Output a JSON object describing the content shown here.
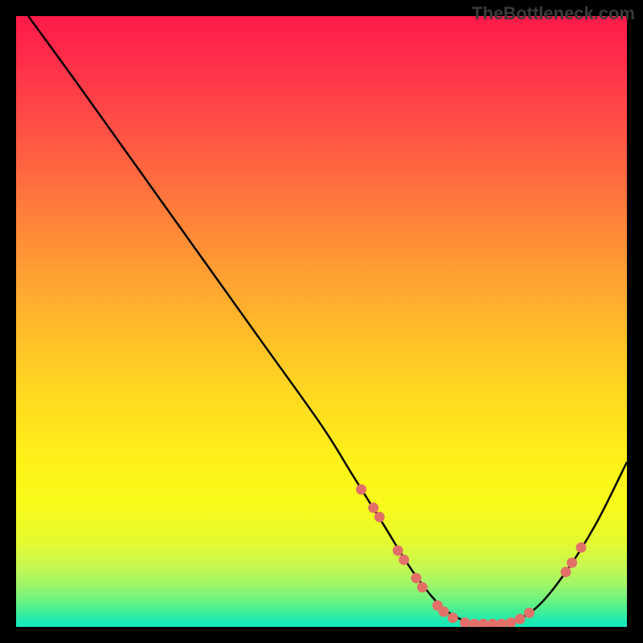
{
  "watermark": "TheBottleneck.com",
  "chart_data": {
    "type": "line",
    "title": "",
    "xlabel": "",
    "ylabel": "",
    "xlim": [
      0,
      100
    ],
    "ylim": [
      0,
      100
    ],
    "series": [
      {
        "name": "bottleneck-curve",
        "color": "#000000",
        "x": [
          2,
          10,
          20,
          30,
          40,
          50,
          55,
          60,
          65,
          70,
          75,
          80,
          85,
          90,
          95,
          100
        ],
        "y": [
          100,
          89,
          75,
          61,
          47,
          33,
          25,
          17,
          9,
          3,
          0.5,
          0.5,
          3,
          9,
          17,
          27
        ]
      }
    ],
    "markers": [
      {
        "name": "highlight-dots",
        "color": "#e27068",
        "points": [
          {
            "x": 56.5,
            "y": 22.5
          },
          {
            "x": 58.5,
            "y": 19.5
          },
          {
            "x": 59.5,
            "y": 18
          },
          {
            "x": 62.5,
            "y": 12.5
          },
          {
            "x": 63.5,
            "y": 11
          },
          {
            "x": 65.5,
            "y": 8
          },
          {
            "x": 66.5,
            "y": 6.5
          },
          {
            "x": 69,
            "y": 3.5
          },
          {
            "x": 70,
            "y": 2.5
          },
          {
            "x": 71.5,
            "y": 1.5
          },
          {
            "x": 73.5,
            "y": 0.7
          },
          {
            "x": 75,
            "y": 0.5
          },
          {
            "x": 76.5,
            "y": 0.5
          },
          {
            "x": 78,
            "y": 0.5
          },
          {
            "x": 79.5,
            "y": 0.5
          },
          {
            "x": 81,
            "y": 0.7
          },
          {
            "x": 82.5,
            "y": 1.3
          },
          {
            "x": 84,
            "y": 2.3
          },
          {
            "x": 90,
            "y": 9
          },
          {
            "x": 91,
            "y": 10.5
          },
          {
            "x": 92.5,
            "y": 13
          }
        ]
      }
    ],
    "gradient_stops": [
      {
        "pos": 0,
        "color": "#ff1a4a"
      },
      {
        "pos": 50,
        "color": "#ffc020"
      },
      {
        "pos": 100,
        "color": "#14e8b8"
      }
    ]
  }
}
